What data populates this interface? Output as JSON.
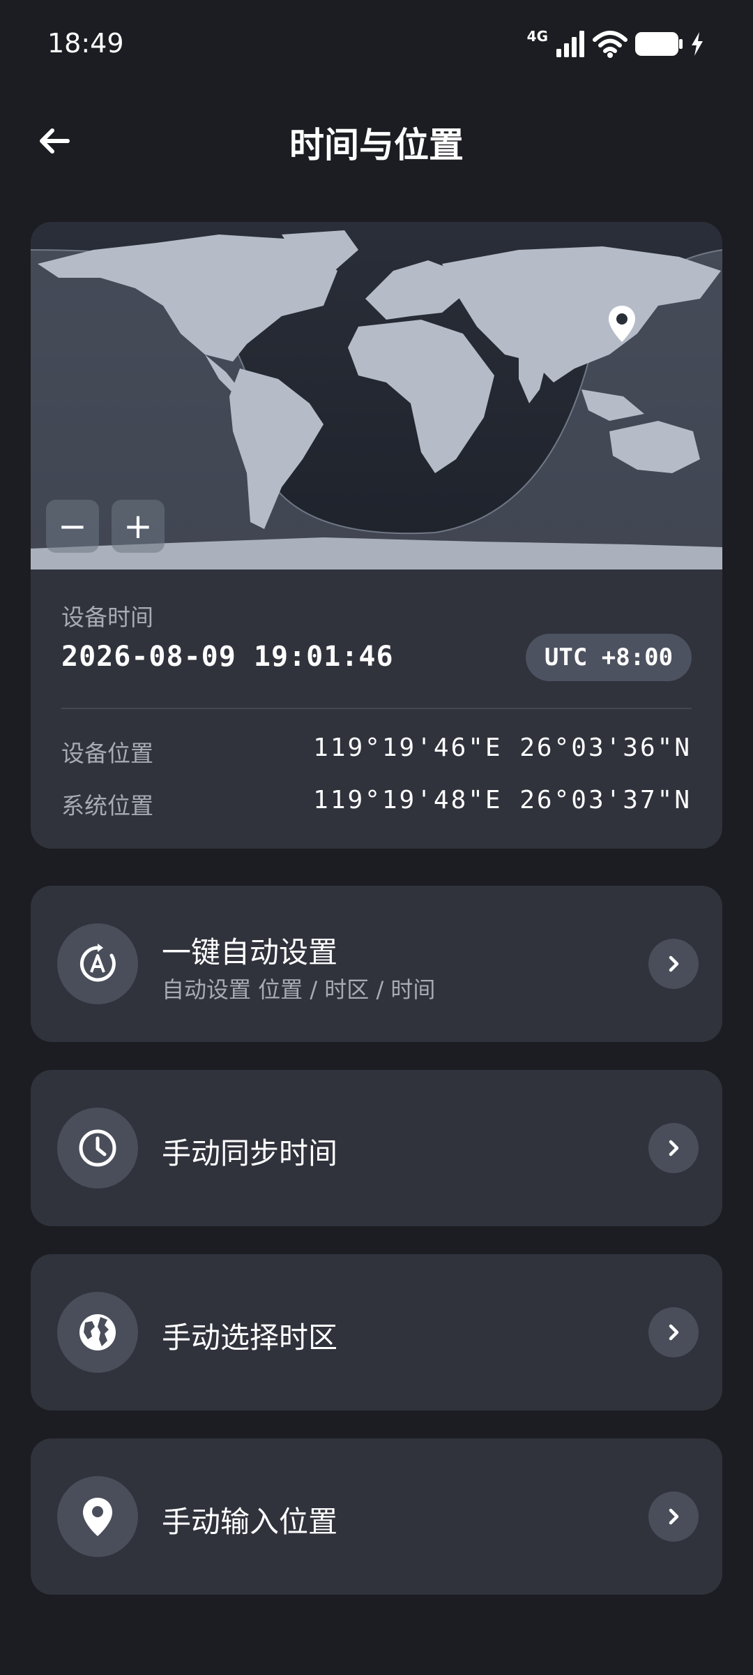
{
  "status_bar": {
    "time": "18:49",
    "network": "4G",
    "icons": [
      "signal-icon",
      "wifi-icon",
      "battery-icon",
      "charging-icon"
    ]
  },
  "header": {
    "title": "时间与位置",
    "back_icon": "arrow-left-icon"
  },
  "map": {
    "zoom_out_label": "−",
    "zoom_in_label": "+",
    "marker_icon": "location-pin-icon"
  },
  "info": {
    "device_time_label": "设备时间",
    "device_time_value": "2026-08-09 19:01:46",
    "timezone": "UTC +8:00",
    "device_location_label": "设备位置",
    "device_location_value": "119°19'46\"E 26°03'36\"N",
    "system_location_label": "系统位置",
    "system_location_value": "119°19'48\"E 26°03'37\"N"
  },
  "actions": [
    {
      "title": "一键自动设置",
      "subtitle": "自动设置 位置 / 时区 / 时间",
      "icon": "auto-sync-icon"
    },
    {
      "title": "手动同步时间",
      "icon": "clock-icon"
    },
    {
      "title": "手动选择时区",
      "icon": "globe-icon"
    },
    {
      "title": "手动输入位置",
      "icon": "location-pin-icon"
    }
  ],
  "colors": {
    "background": "#1c1d22",
    "card": "#30323c",
    "icon_circle": "#4a4e5a",
    "secondary_text": "#a8abb4"
  }
}
